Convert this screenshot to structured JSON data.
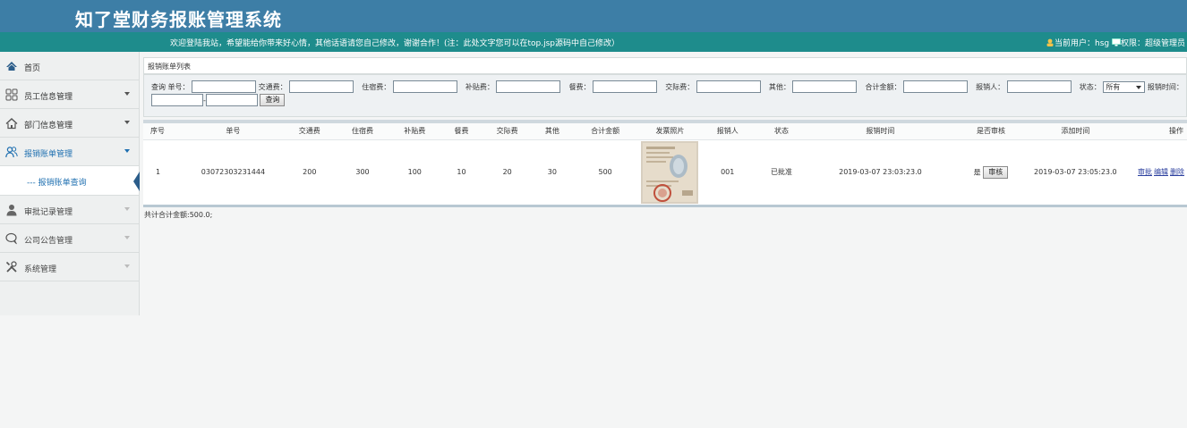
{
  "header": {
    "title": "知了堂财务报账管理系统"
  },
  "notice": {
    "welcome": "欢迎登陆我站，希望能给你带来好心情，其他话语请您自己修改，谢谢合作！(注：此处文字您可以在top.jsp源码中自己修改）",
    "current_user_label": "当前用户：hsg",
    "role_label": "权限：超级管理员"
  },
  "sidebar": {
    "items": [
      {
        "label": "首页",
        "icon": "home-icon"
      },
      {
        "label": "员工信息管理",
        "icon": "grid-icon"
      },
      {
        "label": "部门信息管理",
        "icon": "house-icon"
      },
      {
        "label": "报销账单管理",
        "icon": "users-icon"
      },
      {
        "label": "审批记录管理",
        "icon": "person-icon"
      },
      {
        "label": "公司公告管理",
        "icon": "chat-icon"
      },
      {
        "label": "系统管理",
        "icon": "tools-icon"
      }
    ],
    "sub": {
      "label": "--- 报销账单查询"
    }
  },
  "panel": {
    "title": "报销账单列表"
  },
  "search": {
    "query_label": "查询",
    "fields": {
      "no": "单号：",
      "traffic": "交通费：",
      "lodging": "住宿费：",
      "subsidy": "补贴费：",
      "meal": "餐费：",
      "social": "交际费：",
      "other": "其他：",
      "total": "合计金额：",
      "person": "报销人：",
      "status": "状态：",
      "time": "报销时间："
    },
    "status_selected": "所有",
    "range_sep": "-",
    "submit": "查询"
  },
  "table": {
    "headers": [
      "序号",
      "单号",
      "交通费",
      "住宿费",
      "补贴费",
      "餐费",
      "交际费",
      "其他",
      "合计金额",
      "发票照片",
      "报销人",
      "状态",
      "报销时间",
      "是否审核",
      "添加时间",
      "操作"
    ],
    "rows": [
      {
        "index": "1",
        "no": "03072303231444",
        "traffic": "200",
        "lodging": "300",
        "subsidy": "100",
        "meal": "10",
        "social": "20",
        "other": "30",
        "total": "500",
        "person": "001",
        "status": "已批准",
        "time": "2019-03-07 23:03:23.0",
        "reviewed": "是",
        "review_button": "审核",
        "added": "2019-03-07 23:05:23.0",
        "actions": [
          "审批",
          "编辑",
          "删除"
        ]
      }
    ]
  },
  "footer": {
    "total_text": "共计合计金额:500.0;"
  }
}
